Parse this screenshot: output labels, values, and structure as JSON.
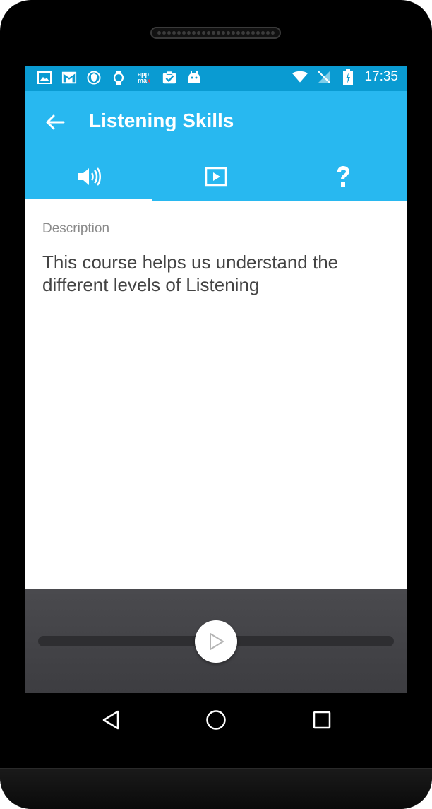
{
  "status_bar": {
    "time": "17:35",
    "left_icons": [
      "image-icon",
      "gmail-icon",
      "shield-icon",
      "watch-icon",
      "appmax-icon",
      "clipboard-check-icon",
      "android-icon"
    ],
    "appmax_top": "app",
    "appmax_bottom": "ma",
    "appmax_x": "x",
    "right_icons": [
      "wifi-icon",
      "no-signal-icon",
      "battery-charging-icon"
    ]
  },
  "toolbar": {
    "title": "Listening Skills",
    "back_icon": "arrow-left-icon"
  },
  "tabs": [
    {
      "icon": "speaker-icon",
      "active": true
    },
    {
      "icon": "video-play-icon",
      "active": false
    },
    {
      "icon": "question-icon",
      "active": false
    }
  ],
  "content": {
    "label": "Description",
    "text": "This course helps us understand the different levels of Listening"
  },
  "player": {
    "play_icon": "play-icon"
  },
  "nav_bar": {
    "icons": [
      "back-triangle-icon",
      "home-circle-icon",
      "recents-square-icon"
    ]
  },
  "colors": {
    "status_bar": "#0a9bd2",
    "primary": "#28b8f0",
    "player_bg": "#434347"
  }
}
